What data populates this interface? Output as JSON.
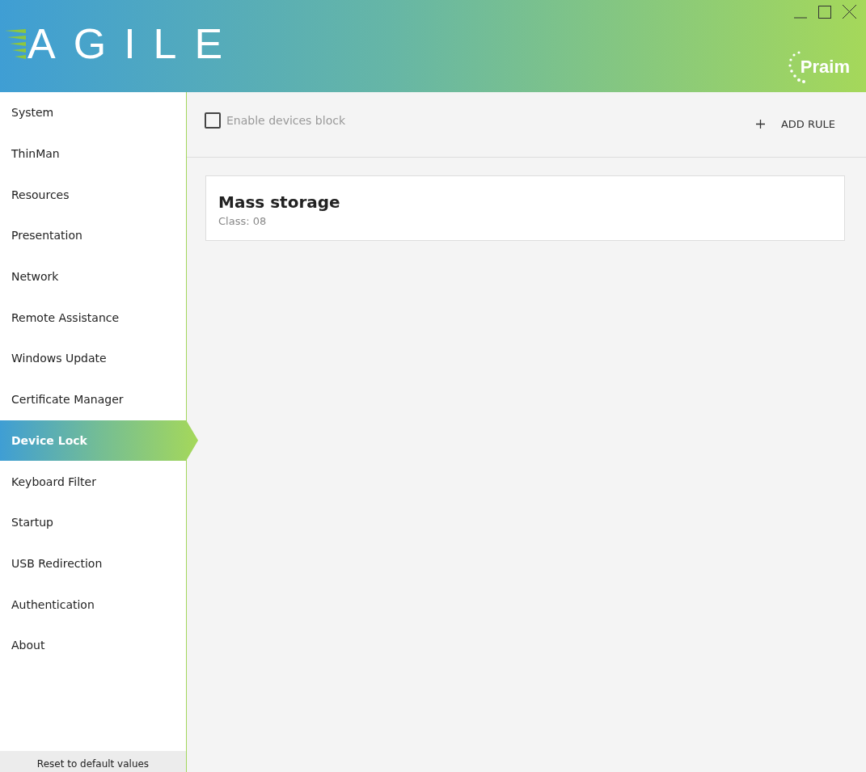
{
  "header": {
    "logo": "AGILE",
    "brand": "Praim"
  },
  "sidebar": {
    "items": [
      {
        "label": "System",
        "selected": false
      },
      {
        "label": "ThinMan",
        "selected": false
      },
      {
        "label": "Resources",
        "selected": false
      },
      {
        "label": "Presentation",
        "selected": false
      },
      {
        "label": "Network",
        "selected": false
      },
      {
        "label": "Remote Assistance",
        "selected": false
      },
      {
        "label": "Windows Update",
        "selected": false
      },
      {
        "label": "Certificate Manager",
        "selected": false
      },
      {
        "label": "Device Lock",
        "selected": true
      },
      {
        "label": "Keyboard Filter",
        "selected": false
      },
      {
        "label": "Startup",
        "selected": false
      },
      {
        "label": "USB Redirection",
        "selected": false
      },
      {
        "label": "Authentication",
        "selected": false
      },
      {
        "label": "About",
        "selected": false
      }
    ],
    "reset_button": "Reset to default values"
  },
  "toolbar": {
    "enable_block": {
      "label": "Enable devices block",
      "checked": false
    },
    "add_rule": "ADD RULE"
  },
  "rules": [
    {
      "title": "Mass storage",
      "subtitle": "Class: 08"
    }
  ]
}
